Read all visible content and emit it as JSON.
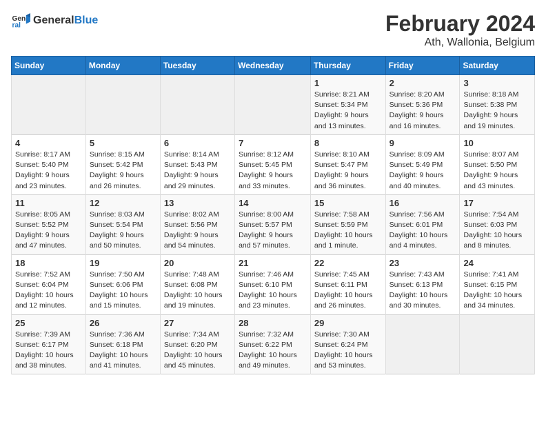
{
  "header": {
    "logo_general": "General",
    "logo_blue": "Blue",
    "title": "February 2024",
    "subtitle": "Ath, Wallonia, Belgium"
  },
  "days_of_week": [
    "Sunday",
    "Monday",
    "Tuesday",
    "Wednesday",
    "Thursday",
    "Friday",
    "Saturday"
  ],
  "weeks": [
    [
      {
        "day": "",
        "info": ""
      },
      {
        "day": "",
        "info": ""
      },
      {
        "day": "",
        "info": ""
      },
      {
        "day": "",
        "info": ""
      },
      {
        "day": "1",
        "info": "Sunrise: 8:21 AM\nSunset: 5:34 PM\nDaylight: 9 hours\nand 13 minutes."
      },
      {
        "day": "2",
        "info": "Sunrise: 8:20 AM\nSunset: 5:36 PM\nDaylight: 9 hours\nand 16 minutes."
      },
      {
        "day": "3",
        "info": "Sunrise: 8:18 AM\nSunset: 5:38 PM\nDaylight: 9 hours\nand 19 minutes."
      }
    ],
    [
      {
        "day": "4",
        "info": "Sunrise: 8:17 AM\nSunset: 5:40 PM\nDaylight: 9 hours\nand 23 minutes."
      },
      {
        "day": "5",
        "info": "Sunrise: 8:15 AM\nSunset: 5:42 PM\nDaylight: 9 hours\nand 26 minutes."
      },
      {
        "day": "6",
        "info": "Sunrise: 8:14 AM\nSunset: 5:43 PM\nDaylight: 9 hours\nand 29 minutes."
      },
      {
        "day": "7",
        "info": "Sunrise: 8:12 AM\nSunset: 5:45 PM\nDaylight: 9 hours\nand 33 minutes."
      },
      {
        "day": "8",
        "info": "Sunrise: 8:10 AM\nSunset: 5:47 PM\nDaylight: 9 hours\nand 36 minutes."
      },
      {
        "day": "9",
        "info": "Sunrise: 8:09 AM\nSunset: 5:49 PM\nDaylight: 9 hours\nand 40 minutes."
      },
      {
        "day": "10",
        "info": "Sunrise: 8:07 AM\nSunset: 5:50 PM\nDaylight: 9 hours\nand 43 minutes."
      }
    ],
    [
      {
        "day": "11",
        "info": "Sunrise: 8:05 AM\nSunset: 5:52 PM\nDaylight: 9 hours\nand 47 minutes."
      },
      {
        "day": "12",
        "info": "Sunrise: 8:03 AM\nSunset: 5:54 PM\nDaylight: 9 hours\nand 50 minutes."
      },
      {
        "day": "13",
        "info": "Sunrise: 8:02 AM\nSunset: 5:56 PM\nDaylight: 9 hours\nand 54 minutes."
      },
      {
        "day": "14",
        "info": "Sunrise: 8:00 AM\nSunset: 5:57 PM\nDaylight: 9 hours\nand 57 minutes."
      },
      {
        "day": "15",
        "info": "Sunrise: 7:58 AM\nSunset: 5:59 PM\nDaylight: 10 hours\nand 1 minute."
      },
      {
        "day": "16",
        "info": "Sunrise: 7:56 AM\nSunset: 6:01 PM\nDaylight: 10 hours\nand 4 minutes."
      },
      {
        "day": "17",
        "info": "Sunrise: 7:54 AM\nSunset: 6:03 PM\nDaylight: 10 hours\nand 8 minutes."
      }
    ],
    [
      {
        "day": "18",
        "info": "Sunrise: 7:52 AM\nSunset: 6:04 PM\nDaylight: 10 hours\nand 12 minutes."
      },
      {
        "day": "19",
        "info": "Sunrise: 7:50 AM\nSunset: 6:06 PM\nDaylight: 10 hours\nand 15 minutes."
      },
      {
        "day": "20",
        "info": "Sunrise: 7:48 AM\nSunset: 6:08 PM\nDaylight: 10 hours\nand 19 minutes."
      },
      {
        "day": "21",
        "info": "Sunrise: 7:46 AM\nSunset: 6:10 PM\nDaylight: 10 hours\nand 23 minutes."
      },
      {
        "day": "22",
        "info": "Sunrise: 7:45 AM\nSunset: 6:11 PM\nDaylight: 10 hours\nand 26 minutes."
      },
      {
        "day": "23",
        "info": "Sunrise: 7:43 AM\nSunset: 6:13 PM\nDaylight: 10 hours\nand 30 minutes."
      },
      {
        "day": "24",
        "info": "Sunrise: 7:41 AM\nSunset: 6:15 PM\nDaylight: 10 hours\nand 34 minutes."
      }
    ],
    [
      {
        "day": "25",
        "info": "Sunrise: 7:39 AM\nSunset: 6:17 PM\nDaylight: 10 hours\nand 38 minutes."
      },
      {
        "day": "26",
        "info": "Sunrise: 7:36 AM\nSunset: 6:18 PM\nDaylight: 10 hours\nand 41 minutes."
      },
      {
        "day": "27",
        "info": "Sunrise: 7:34 AM\nSunset: 6:20 PM\nDaylight: 10 hours\nand 45 minutes."
      },
      {
        "day": "28",
        "info": "Sunrise: 7:32 AM\nSunset: 6:22 PM\nDaylight: 10 hours\nand 49 minutes."
      },
      {
        "day": "29",
        "info": "Sunrise: 7:30 AM\nSunset: 6:24 PM\nDaylight: 10 hours\nand 53 minutes."
      },
      {
        "day": "",
        "info": ""
      },
      {
        "day": "",
        "info": ""
      }
    ]
  ]
}
